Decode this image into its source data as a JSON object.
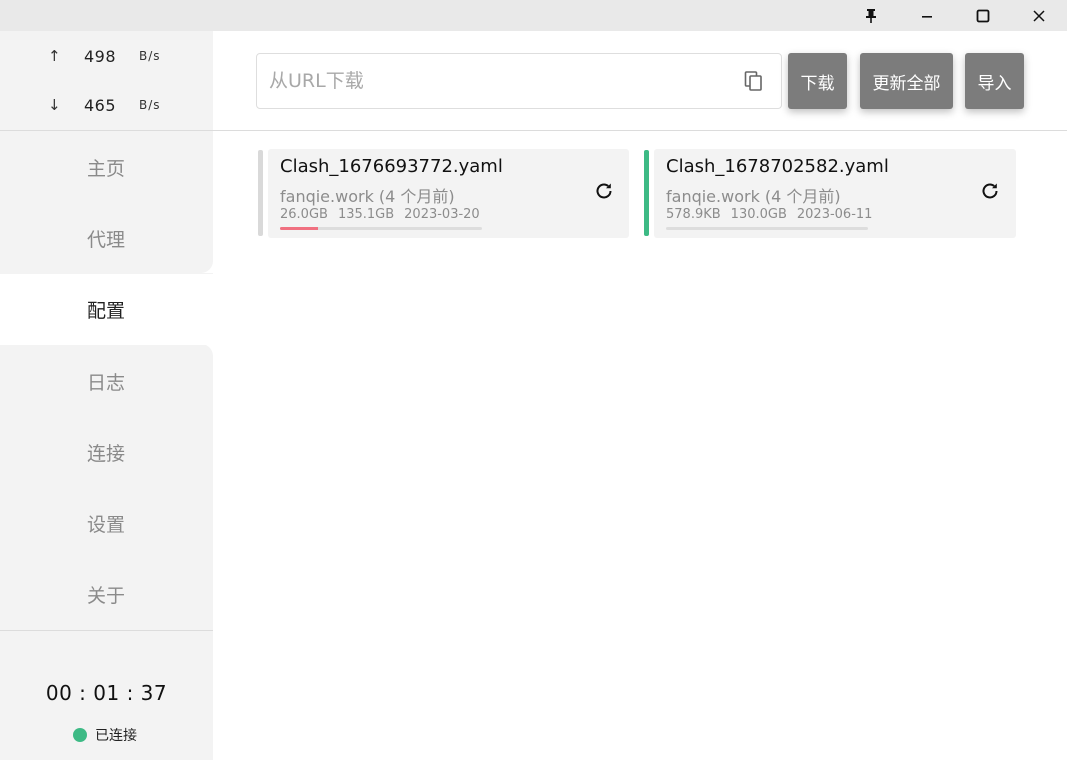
{
  "window": {
    "buttons": [
      "pin-icon",
      "minimize-icon",
      "maximize-icon",
      "close-icon"
    ]
  },
  "sidebar": {
    "traffic": {
      "up": {
        "arrow": "↑",
        "value": "498",
        "unit": "B/s"
      },
      "down": {
        "arrow": "↓",
        "value": "465",
        "unit": "B/s"
      }
    },
    "items": [
      {
        "label": "主页",
        "active": false
      },
      {
        "label": "代理",
        "active": false
      },
      {
        "label": "配置",
        "active": true
      },
      {
        "label": "日志",
        "active": false
      },
      {
        "label": "连接",
        "active": false
      },
      {
        "label": "设置",
        "active": false
      },
      {
        "label": "关于",
        "active": false
      }
    ],
    "timer": "00 : 01 : 37",
    "status": {
      "label": "已连接",
      "color": "#3dba85"
    }
  },
  "toolbar": {
    "url_placeholder": "从URL下载",
    "url_value": "",
    "download_label": "下载",
    "update_all_label": "更新全部",
    "import_label": "导入"
  },
  "profiles": [
    {
      "name": "Clash_1676693772.yaml",
      "source": "fanqie.work (4 个月前)",
      "used": "26.0GB",
      "total": "135.1GB",
      "expire": "2023-03-20",
      "usage_fraction": 0.19,
      "selected": false,
      "indicator_color": "#d9d9d9"
    },
    {
      "name": "Clash_1678702582.yaml",
      "source": "fanqie.work (4 个月前)",
      "used": "578.9KB",
      "total": "130.0GB",
      "expire": "2023-06-11",
      "usage_fraction": 0.0,
      "selected": true,
      "indicator_color": "#3dba85"
    }
  ]
}
